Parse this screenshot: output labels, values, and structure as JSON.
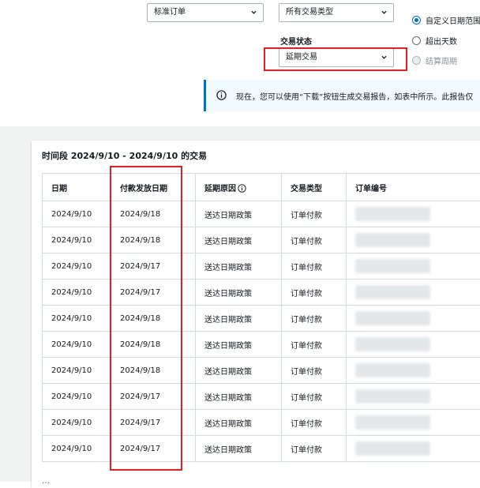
{
  "filters": {
    "order_type_select": "标准订单",
    "transaction_type_select": "所有交易类型",
    "status_label": "交易状态",
    "status_select": "延期交易"
  },
  "date_options": [
    {
      "label": "自定义日期范围",
      "checked": true,
      "disabled": false
    },
    {
      "label": "超出天数",
      "checked": false,
      "disabled": false
    },
    {
      "label": "结算周期",
      "checked": false,
      "disabled": true
    }
  ],
  "info_message": "现在，您可以使用“下载”按钮生成交易报告，如表中所示。此报告仅",
  "period_title": "时间段 2024/9/10 - 2024/9/10 的交易",
  "table": {
    "headers": [
      "日期",
      "付款发放日期",
      "延期原因",
      "交易类型",
      "订单编号"
    ],
    "rows": [
      [
        "2024/9/10",
        "2024/9/18",
        "送达日期政策",
        "订单付款"
      ],
      [
        "2024/9/10",
        "2024/9/18",
        "送达日期政策",
        "订单付款"
      ],
      [
        "2024/9/10",
        "2024/9/17",
        "送达日期政策",
        "订单付款"
      ],
      [
        "2024/9/10",
        "2024/9/17",
        "送达日期政策",
        "订单付款"
      ],
      [
        "2024/9/10",
        "2024/9/18",
        "送达日期政策",
        "订单付款"
      ],
      [
        "2024/9/10",
        "2024/9/18",
        "送达日期政策",
        "订单付款"
      ],
      [
        "2024/9/10",
        "2024/9/18",
        "送达日期政策",
        "订单付款"
      ],
      [
        "2024/9/10",
        "2024/9/17",
        "送达日期政策",
        "订单付款"
      ],
      [
        "2024/9/10",
        "2024/9/17",
        "送达日期政策",
        "订单付款"
      ],
      [
        "2024/9/10",
        "2024/9/17",
        "送达日期政策",
        "订单付款"
      ]
    ]
  },
  "footer": "…",
  "colors": {
    "accent": "#0073bb",
    "highlight": "#e02020",
    "info_bg": "#f1faff"
  }
}
